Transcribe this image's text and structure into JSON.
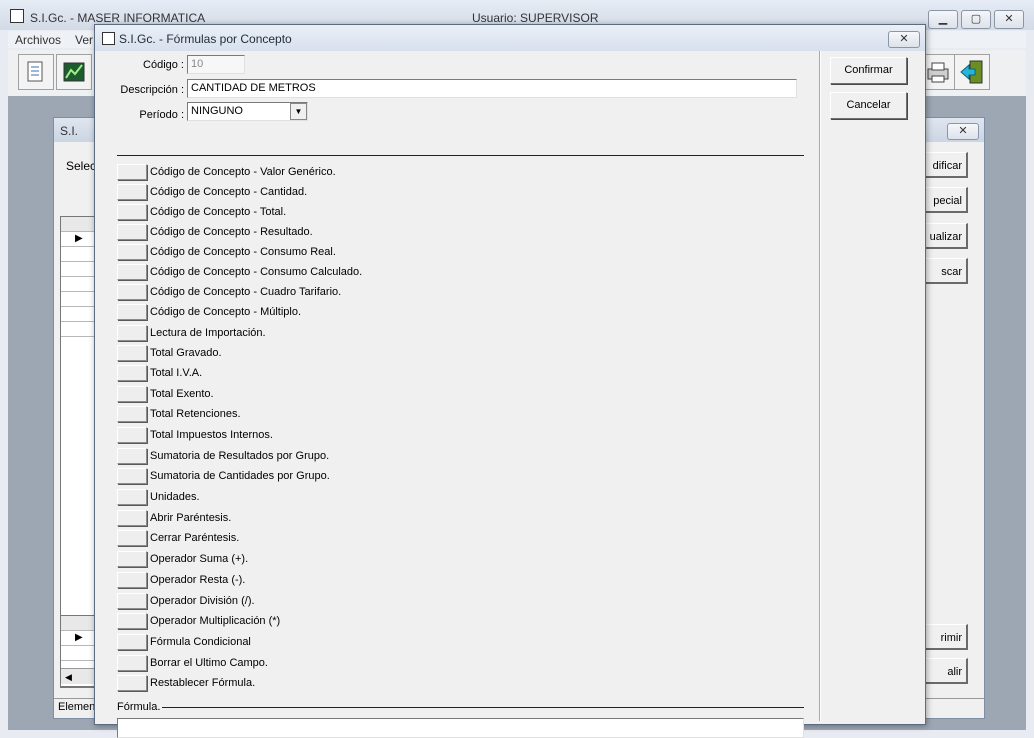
{
  "main_window": {
    "title": "S.I.Gc. - MASER INFORMATICA",
    "user_label": "Usuario: SUPERVISOR",
    "minimize": "▁",
    "maximize": "▢",
    "close": "✕",
    "menu": [
      "Archivos",
      "Ver"
    ]
  },
  "background_window": {
    "title": "S.I.",
    "select_label": "Selec",
    "status": "Elemen",
    "buttons": [
      "dificar",
      "pecial",
      "ualizar",
      "scar",
      "rimir",
      "alir"
    ]
  },
  "dialog": {
    "title": "S.I.Gc. - Fórmulas por Concepto",
    "close": "✕",
    "codigo_label": "Código :",
    "codigo_value": "10",
    "descripcion_label": "Descripción :",
    "descripcion_value": "CANTIDAD DE METROS",
    "periodo_label": "Período :",
    "periodo_value": "NINGUNO",
    "options": [
      "Código de Concepto - Valor Genérico.",
      "Código de Concepto - Cantidad.",
      "Código de Concepto - Total.",
      "Código de Concepto - Resultado.",
      "Código de Concepto - Consumo Real.",
      "Código de Concepto - Consumo Calculado.",
      "Código de Concepto - Cuadro Tarifario.",
      "Código de Concepto - Múltiplo.",
      "Lectura de Importación.",
      "Total Gravado.",
      "Total I.V.A.",
      "Total Exento.",
      "Total Retenciones.",
      "Total Impuestos Internos.",
      "Sumatoria de Resultados por Grupo.",
      "Sumatoria de Cantidades por Grupo.",
      "Unidades.",
      "Abrir Paréntesis.",
      "Cerrar Paréntesis.",
      "Operador Suma (+).",
      "Operador Resta (-).",
      "Operador División (/).",
      "Operador Multiplicación (*)",
      "Fórmula Condicional",
      "Borrar el Ultimo Campo.",
      "Restablecer Fórmula."
    ],
    "formula_label": "Fórmula.",
    "formula_value": "",
    "confirm_label": "Confirmar",
    "cancel_label": "Cancelar"
  }
}
